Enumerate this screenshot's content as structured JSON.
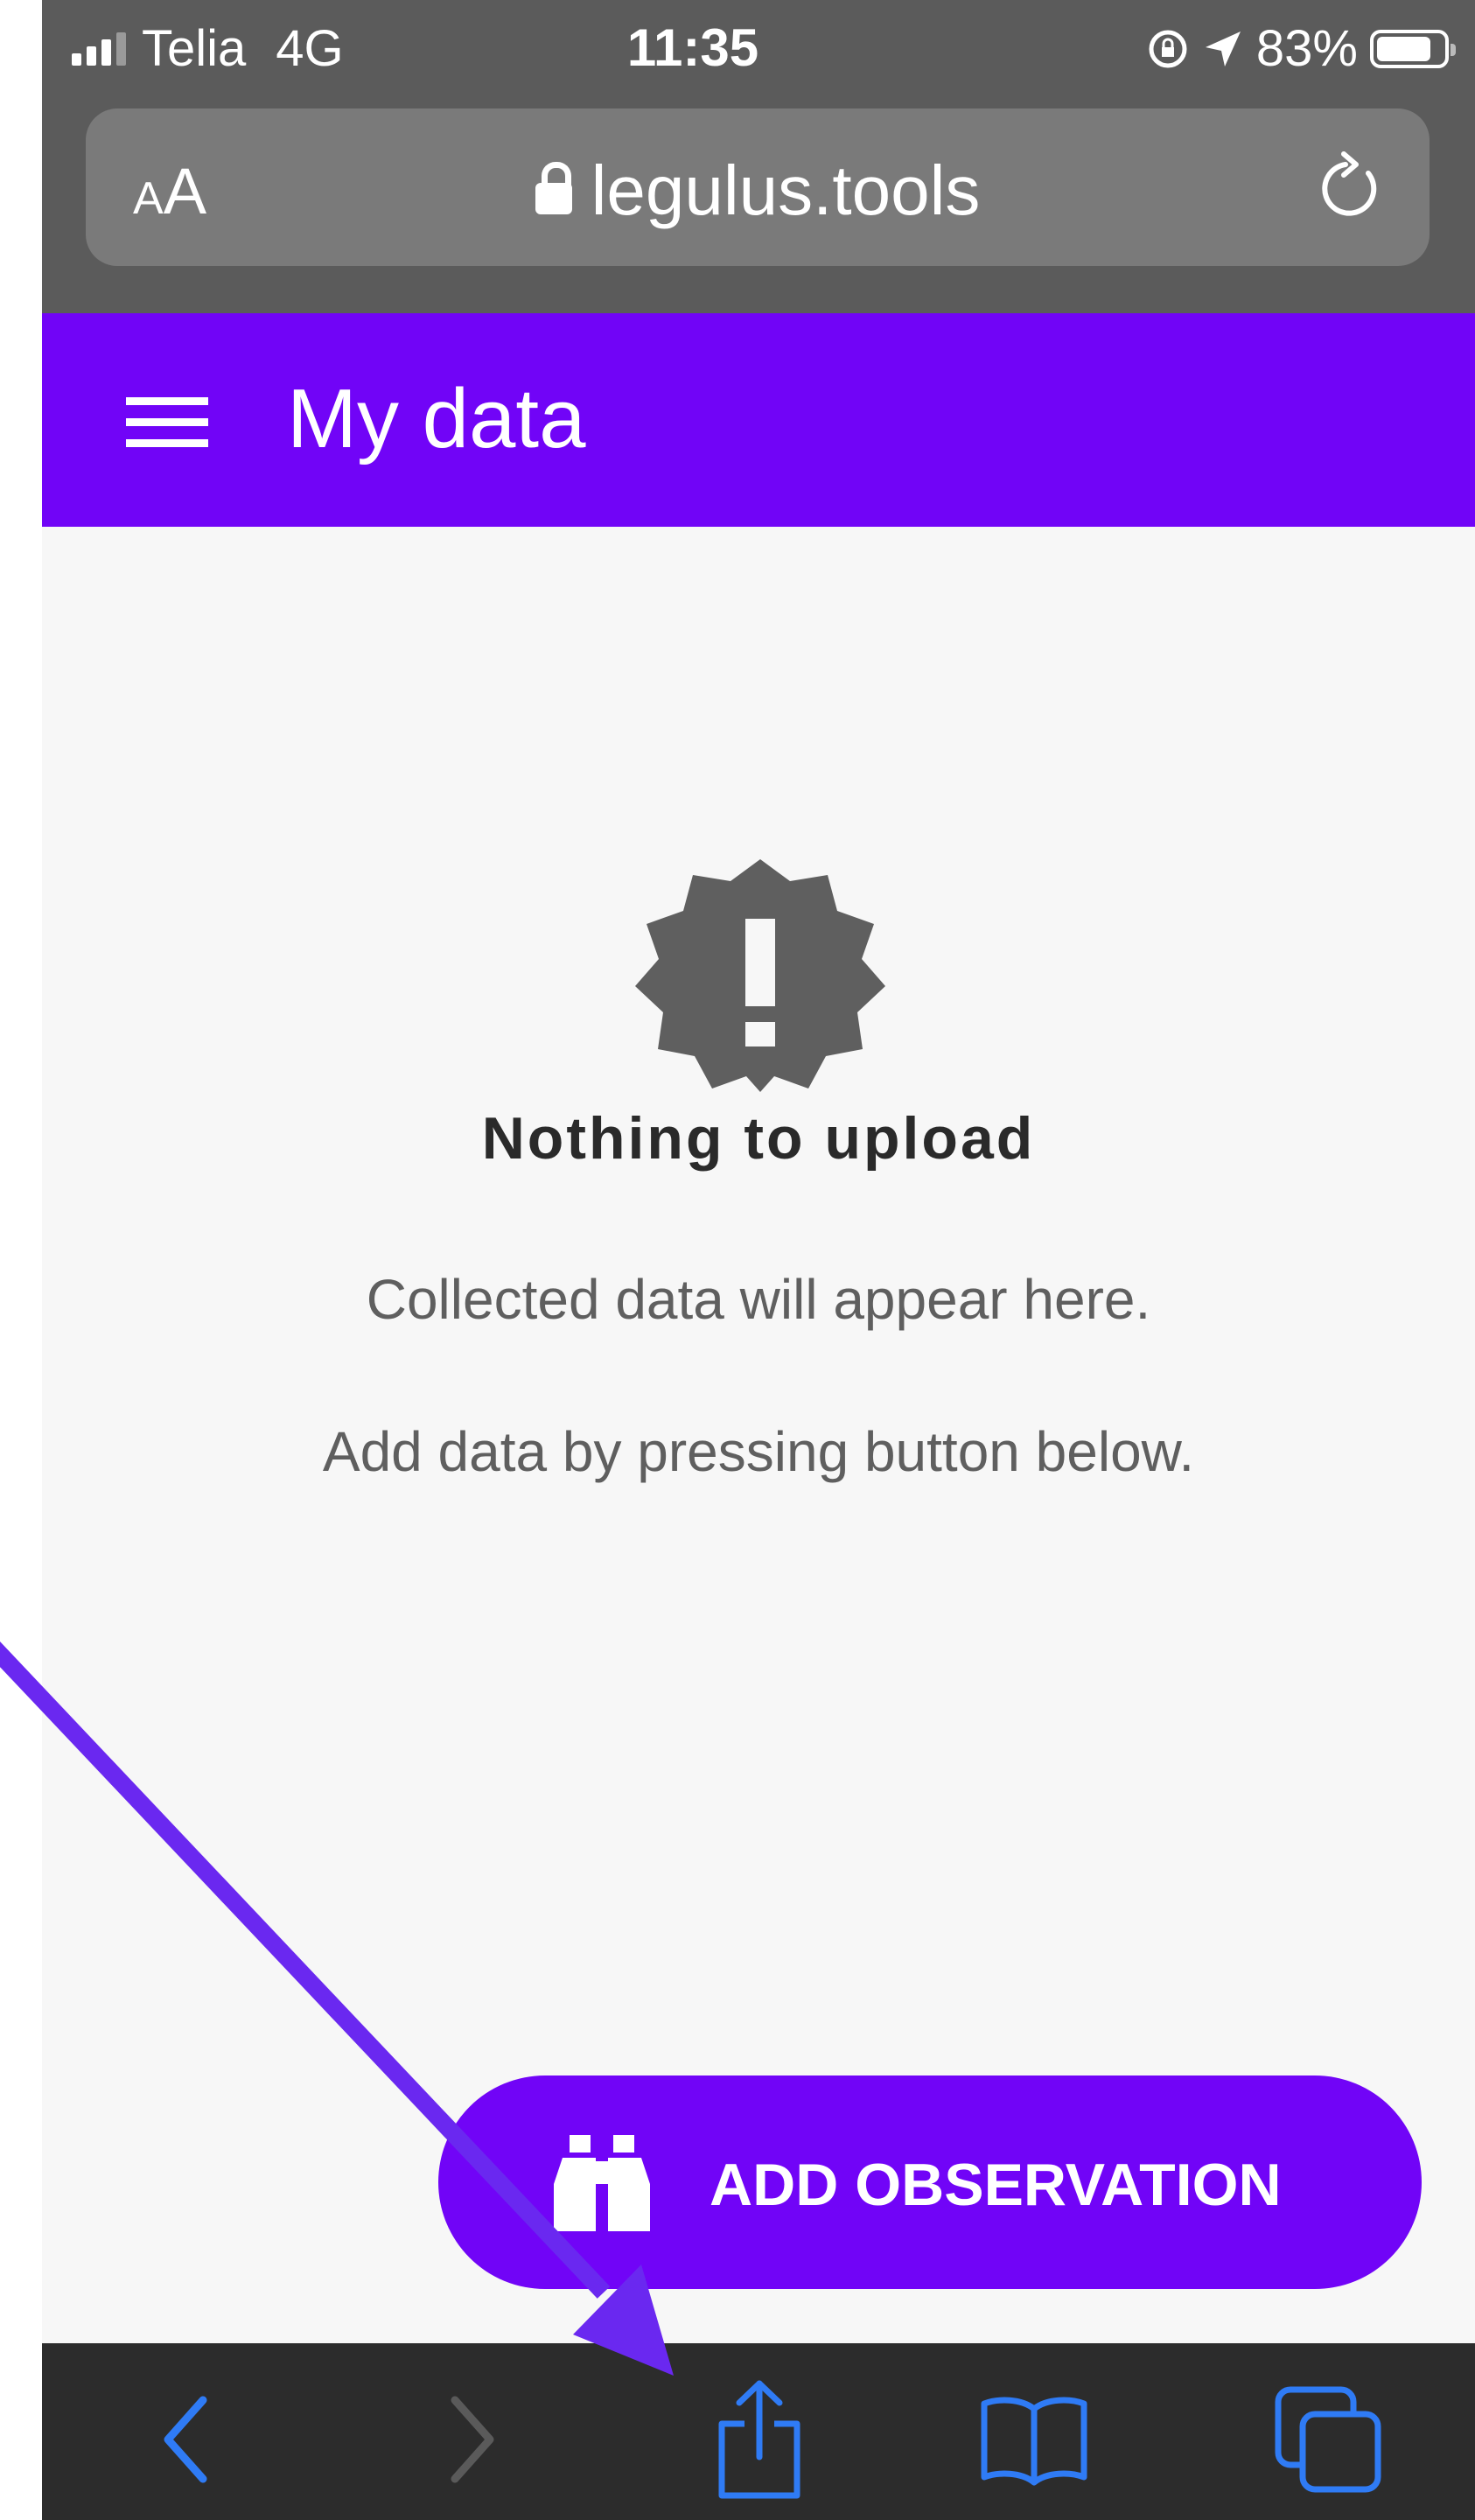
{
  "status_bar": {
    "carrier": "Telia",
    "network": "4G",
    "time": "11:35",
    "battery": "83%",
    "battery_level": 0.83
  },
  "browser": {
    "text_size_label_small": "A",
    "text_size_label_large": "A",
    "url": "legulus.tools"
  },
  "app_bar": {
    "title": "My data"
  },
  "empty_state": {
    "title": "Nothing to upload",
    "line1": "Collected data will appear here.",
    "line2": "Add data by pressing button below."
  },
  "fab": {
    "label": "ADD OBSERVATION"
  },
  "colors": {
    "accent": "#7104f7",
    "annotation_arrow": "#6a28f0",
    "toolbar_icon": "#2f7bf5"
  },
  "icons": {
    "badge": "alert-badge-icon",
    "fab": "binoculars-icon",
    "toolbar": [
      "back-icon",
      "forward-icon",
      "share-icon",
      "bookmarks-icon",
      "tabs-icon"
    ]
  }
}
